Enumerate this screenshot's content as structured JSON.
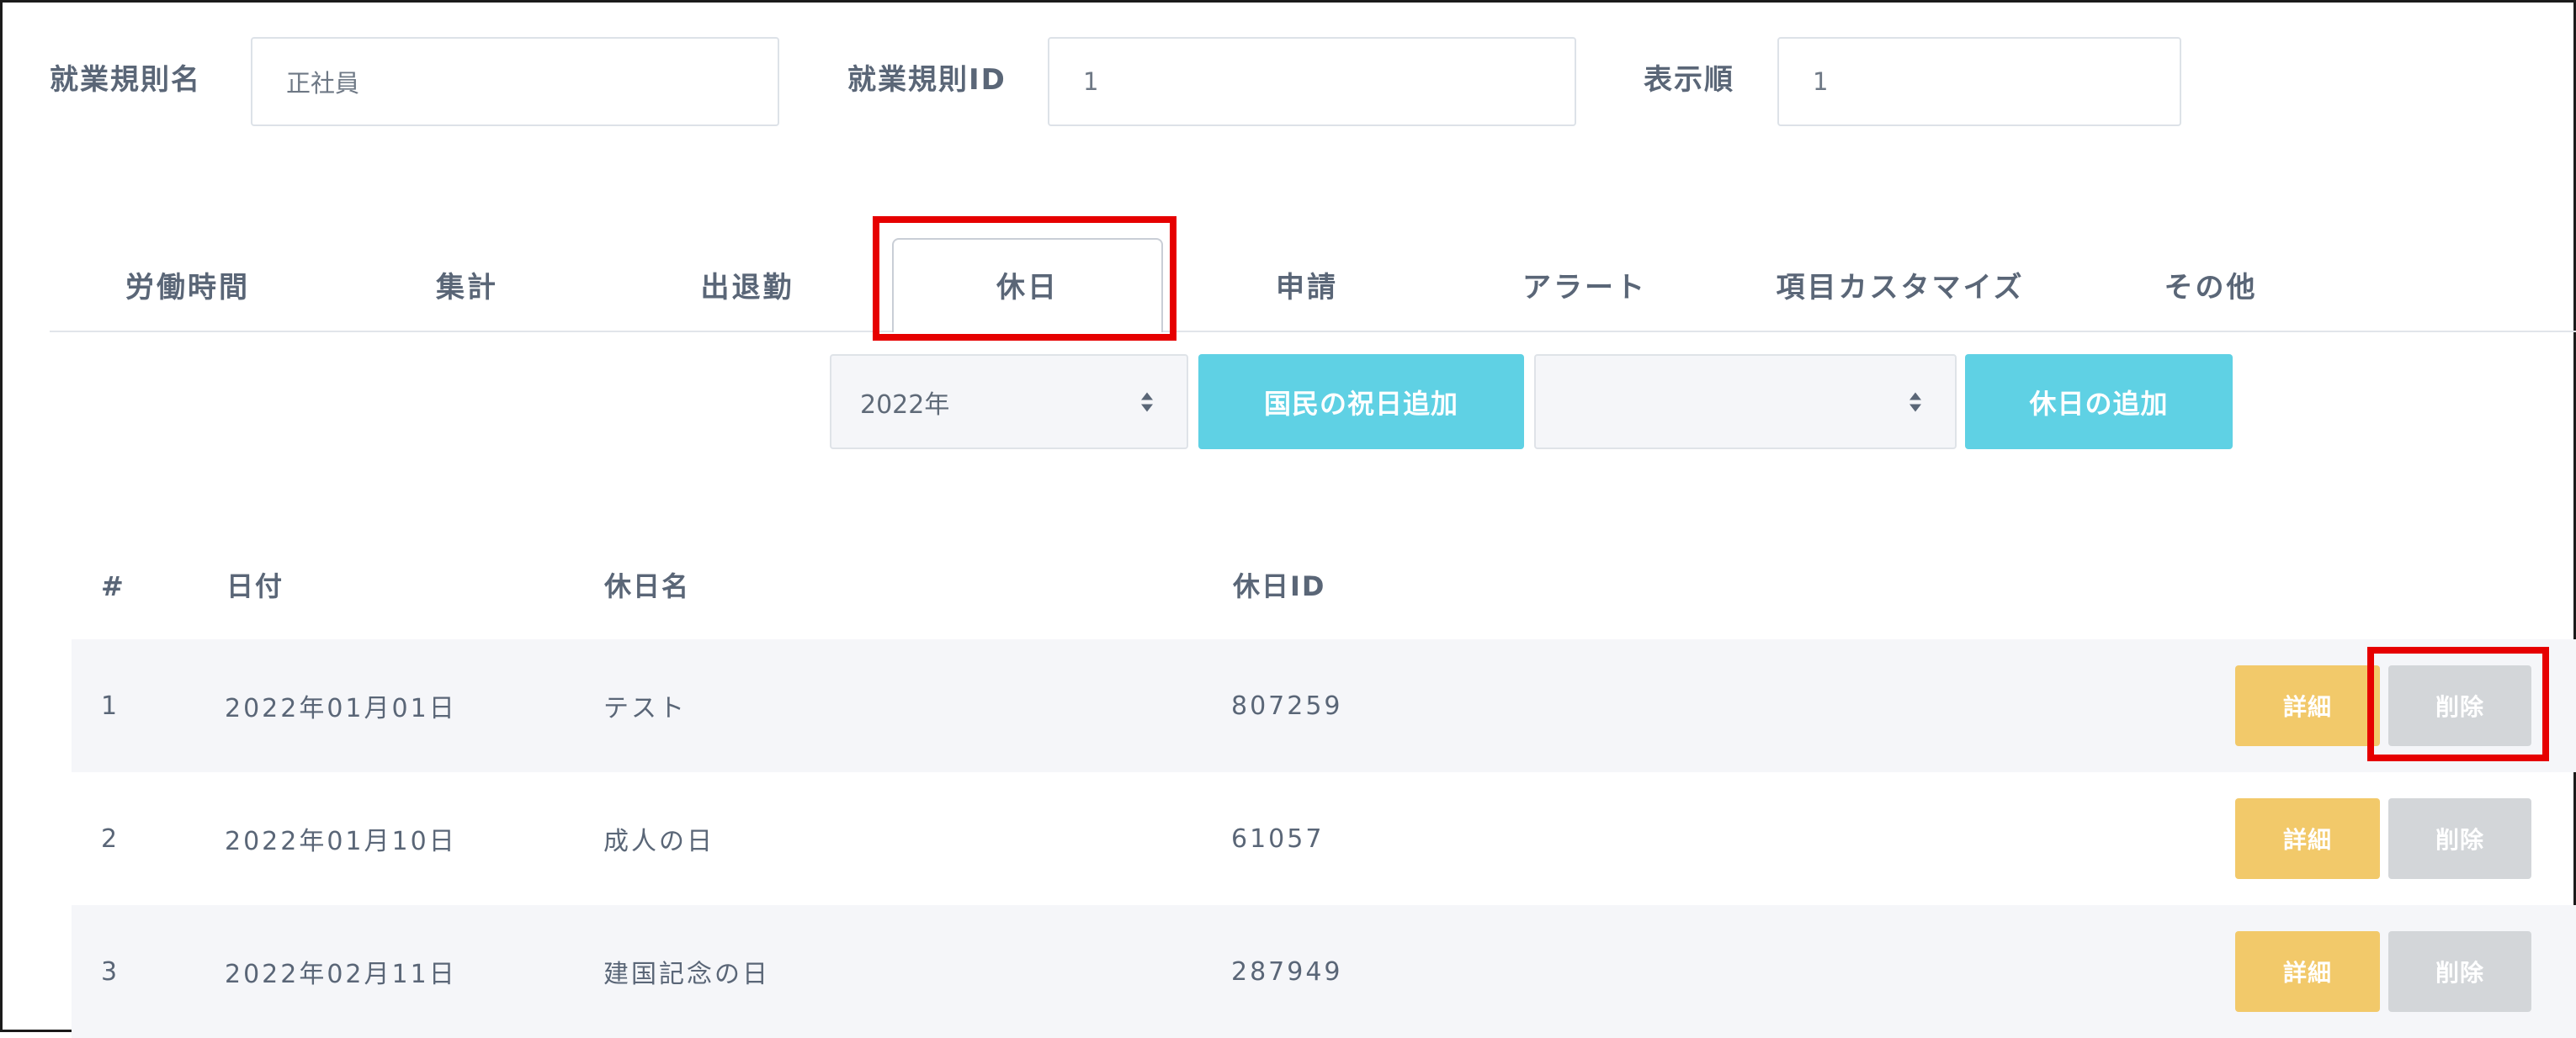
{
  "form": {
    "rule_name_label": "就業規則名",
    "rule_name_value": "正社員",
    "rule_id_label": "就業規則ID",
    "rule_id_value": "1",
    "display_order_label": "表示順",
    "display_order_value": "1"
  },
  "tabs": [
    {
      "label": "労働時間"
    },
    {
      "label": "集計"
    },
    {
      "label": "出退勤"
    },
    {
      "label": "休日",
      "active": true
    },
    {
      "label": "申請"
    },
    {
      "label": "アラート"
    },
    {
      "label": "項目カスタマイズ"
    },
    {
      "label": "その他"
    }
  ],
  "toolbar": {
    "year_select_value": "2022年",
    "national_holiday_button": "国民の祝日追加",
    "holiday_select_value": "",
    "add_holiday_button": "休日の追加"
  },
  "table": {
    "headers": {
      "index": "#",
      "date": "日付",
      "name": "休日名",
      "id": "休日ID"
    },
    "rows": [
      {
        "index": "1",
        "date": "2022年01月01日",
        "name": "テスト",
        "id": "807259"
      },
      {
        "index": "2",
        "date": "2022年01月10日",
        "name": "成人の日",
        "id": "61057"
      },
      {
        "index": "3",
        "date": "2022年02月11日",
        "name": "建国記念の日",
        "id": "287949"
      }
    ],
    "detail_label": "詳細",
    "delete_label": "削除"
  },
  "colors": {
    "accent_info": "#5fd1e4",
    "warning": "#f2c96a",
    "disabled": "#d3d6d9",
    "highlight": "#e60000"
  }
}
